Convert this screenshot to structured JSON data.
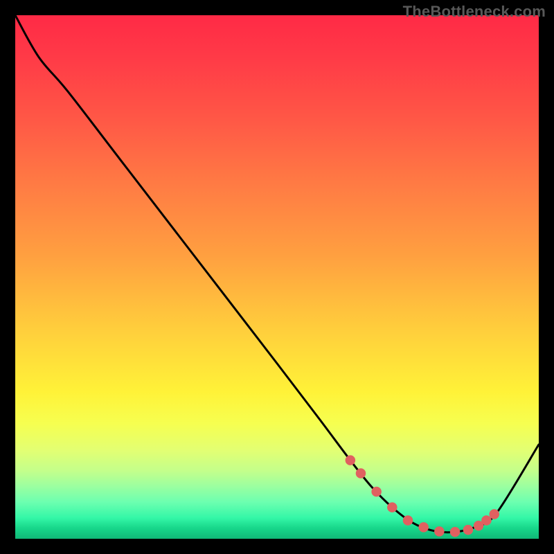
{
  "watermark": "TheBottleneck.com",
  "chart_data": {
    "type": "line",
    "title": "",
    "xlabel": "",
    "ylabel": "",
    "xlim": [
      0,
      100
    ],
    "ylim": [
      0,
      100
    ],
    "grid": false,
    "series": [
      {
        "name": "curve",
        "x": [
          0,
          4.5,
          10,
          20,
          30,
          40,
          50,
          58,
          64,
          68,
          72,
          76,
          80,
          84,
          88,
          92,
          100
        ],
        "y": [
          100,
          92,
          85.5,
          72.5,
          59.5,
          46.5,
          33.5,
          23,
          15,
          10,
          6,
          3,
          1.5,
          1.3,
          2.3,
          5,
          18
        ],
        "stroke": "#000000",
        "marker_points": {
          "x": [
            64,
            66,
            69,
            72,
            75,
            78,
            81,
            84,
            86.5,
            88.5,
            90,
            91.5
          ],
          "y": [
            15,
            12.5,
            9,
            6,
            3.5,
            2.2,
            1.4,
            1.3,
            1.7,
            2.5,
            3.5,
            4.7
          ],
          "color": "#e06060",
          "radius": 2.2
        }
      }
    ],
    "background_gradient": [
      "#ff2a46",
      "#ffce3c",
      "#fff238",
      "#10b877"
    ]
  }
}
